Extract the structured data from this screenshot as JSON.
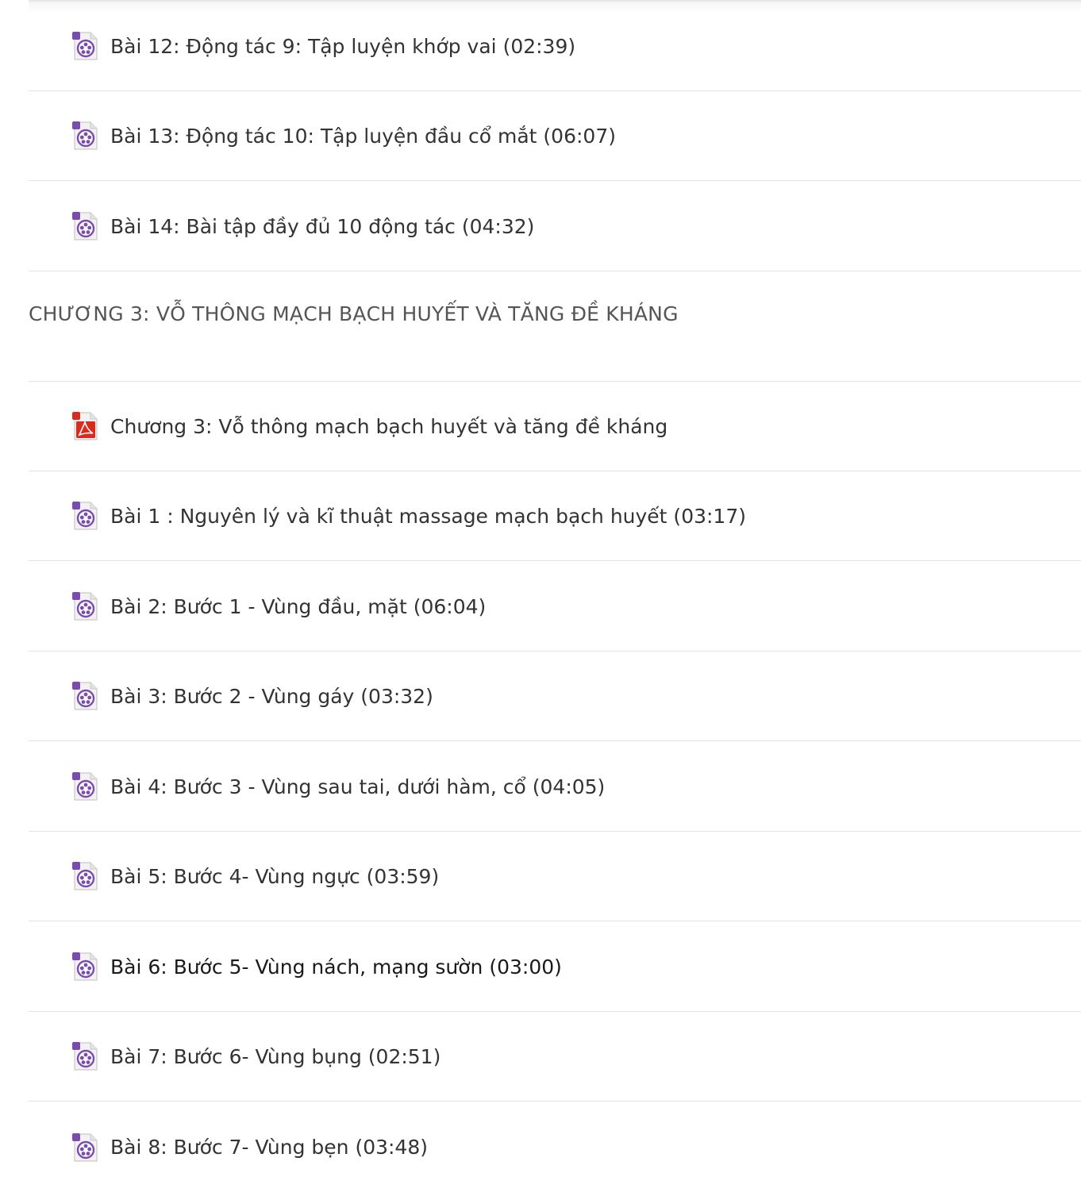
{
  "lessons_before": [
    {
      "icon": "video-file-icon",
      "label": "Bài 12: Động tác 9: Tập luyện khớp vai (02:39)"
    },
    {
      "icon": "video-file-icon",
      "label": "Bài 13: Động tác 10: Tập luyện đầu cổ mắt (06:07)"
    },
    {
      "icon": "video-file-icon",
      "label": "Bài 14: Bài tập đầy đủ 10 động tác (04:32)"
    }
  ],
  "chapter": {
    "title": "CHƯƠNG 3: VỖ THÔNG MẠCH BẠCH HUYẾT VÀ TĂNG ĐỀ KHÁNG"
  },
  "lessons_after": [
    {
      "icon": "pdf-file-icon",
      "label": "Chương 3: Vỗ thông mạch bạch huyết và tăng đề kháng"
    },
    {
      "icon": "video-file-icon",
      "label": "Bài 1 : Nguyên lý và kĩ thuật massage mạch bạch huyết (03:17)"
    },
    {
      "icon": "video-file-icon",
      "label": "Bài 2: Bước 1 - Vùng đầu, mặt (06:04)"
    },
    {
      "icon": "video-file-icon",
      "label": "Bài 3: Bước 2 - Vùng gáy (03:32)"
    },
    {
      "icon": "video-file-icon",
      "label": "Bài 4: Bước 3 - Vùng sau tai, dưới hàm, cổ (04:05)"
    },
    {
      "icon": "video-file-icon",
      "label": "Bài 5: Bước 4- Vùng ngực (03:59)"
    },
    {
      "icon": "video-file-icon",
      "label": "Bài 6: Bước 5- Vùng nách, mạng sườn (03:00)"
    },
    {
      "icon": "video-file-icon",
      "label": "Bài 7: Bước 6- Vùng bụng (02:51)"
    },
    {
      "icon": "video-file-icon",
      "label": "Bài 8: Bước 7- Vùng bẹn (03:48)"
    }
  ],
  "colors": {
    "text": "#333333",
    "chapter_text": "#555555",
    "divider": "#e3e3e3",
    "video_icon_accent": "#7b4bb0",
    "pdf_icon_accent": "#d92b1e"
  }
}
